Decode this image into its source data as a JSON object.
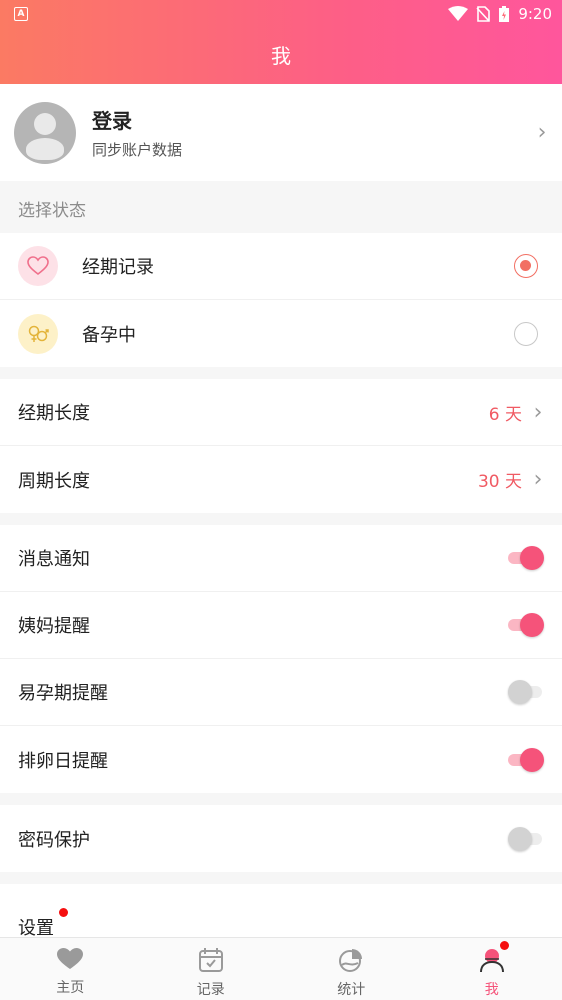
{
  "status": {
    "time": "9:20",
    "badge": "A"
  },
  "header": {
    "title": "我"
  },
  "profile": {
    "name": "登录",
    "subtitle": "同步账户数据"
  },
  "state_section": {
    "title": "选择状态",
    "items": [
      {
        "label": "经期记录",
        "icon": "heart-icon",
        "selected": true
      },
      {
        "label": "备孕中",
        "icon": "gender-rings-icon",
        "selected": false
      }
    ]
  },
  "cycle": {
    "period_length": {
      "label": "经期长度",
      "value": "6 天"
    },
    "cycle_length": {
      "label": "周期长度",
      "value": "30 天"
    }
  },
  "notifications": {
    "items": [
      {
        "label": "消息通知",
        "on": true
      },
      {
        "label": "姨妈提醒",
        "on": true
      },
      {
        "label": "易孕期提醒",
        "on": false
      },
      {
        "label": "排卵日提醒",
        "on": true
      }
    ]
  },
  "security": {
    "label": "密码保护",
    "on": false
  },
  "settings": {
    "label": "设置"
  },
  "tabs": [
    {
      "label": "主页",
      "icon": "heart-icon"
    },
    {
      "label": "记录",
      "icon": "calendar-icon"
    },
    {
      "label": "统计",
      "icon": "pie-chart-icon"
    },
    {
      "label": "我",
      "icon": "user-icon",
      "active": true
    }
  ],
  "colors": {
    "accent": "#f5537a",
    "value_red": "#f05a63",
    "radio_on": "#f26f63"
  }
}
